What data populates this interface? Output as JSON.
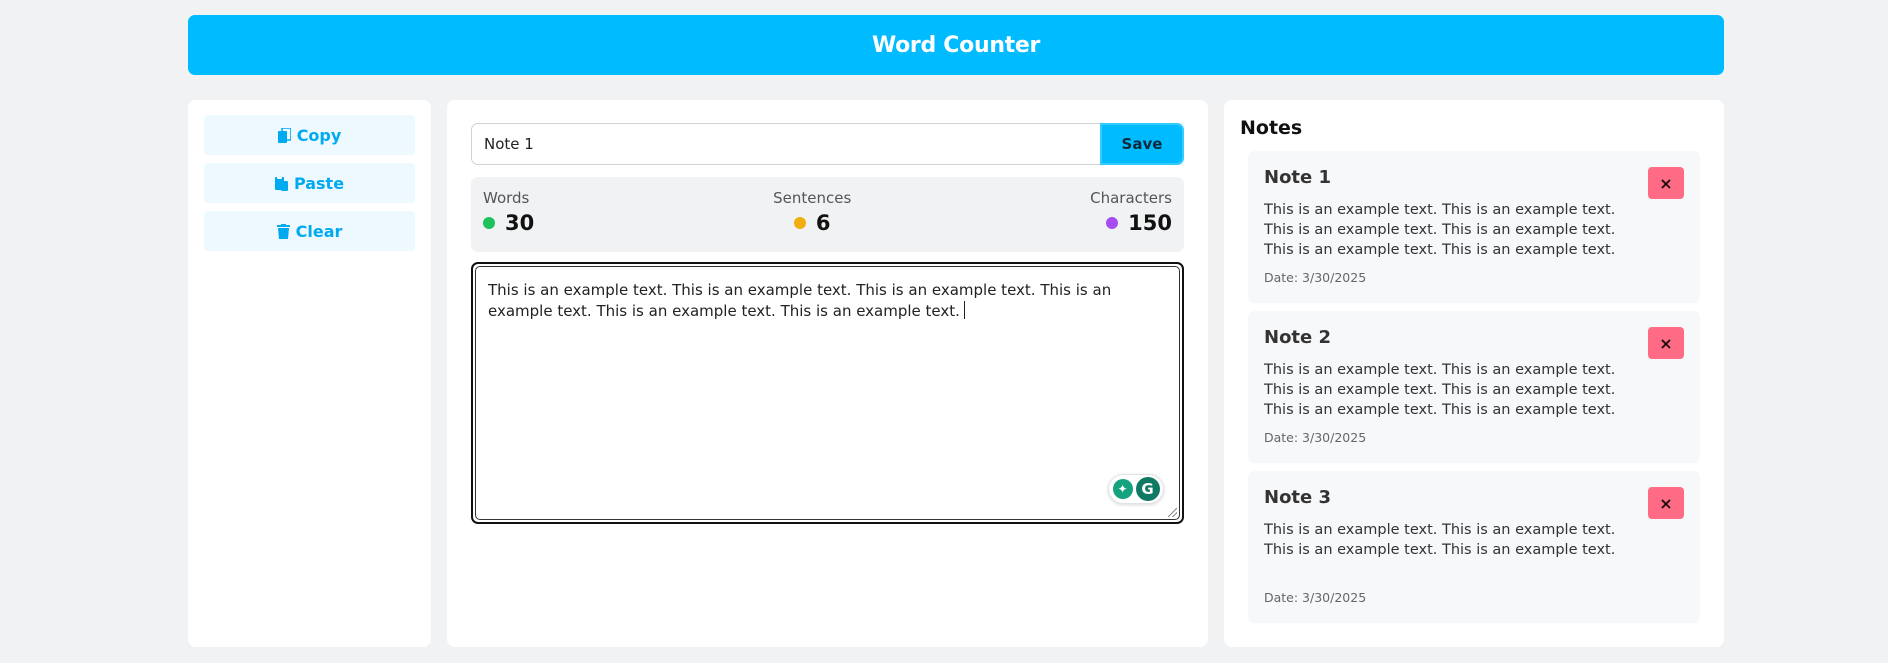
{
  "app": {
    "title": "Word Counter"
  },
  "sidebar": {
    "buttons": [
      {
        "label": "Copy",
        "icon": "copy-icon"
      },
      {
        "label": "Paste",
        "icon": "paste-icon"
      },
      {
        "label": "Clear",
        "icon": "trash-icon"
      }
    ]
  },
  "editor": {
    "note_name_value": "Note 1",
    "save_label": "Save",
    "text": "This is an example text. This is an example text. This is an example text. This is an example text. This is an example text. This is an example text."
  },
  "stats": {
    "words": {
      "label": "Words",
      "value": "30",
      "color": "#1fc25a"
    },
    "sentences": {
      "label": "Sentences",
      "value": "6",
      "color": "#f0ad10"
    },
    "characters": {
      "label": "Characters",
      "value": "150",
      "color": "#a64df0"
    }
  },
  "notes": {
    "title": "Notes",
    "delete_label": "×",
    "items": [
      {
        "title": "Note 1",
        "text": "This is an example text. This is an example text. This is an example text. This is an example text. This is an example text. This is an example text.",
        "date": "Date: 3/30/2025"
      },
      {
        "title": "Note 2",
        "text": "This is an example text. This is an example text. This is an example text. This is an example text. This is an example text. This is an example text. This is an…",
        "date": "Date: 3/30/2025"
      },
      {
        "title": "Note 3",
        "text": "This is an example text. This is an example text. This is an example text. This is an example text.",
        "date": "Date: 3/30/2025"
      }
    ]
  },
  "colors": {
    "accent": "#00bbff",
    "danger": "#ff6b85"
  }
}
